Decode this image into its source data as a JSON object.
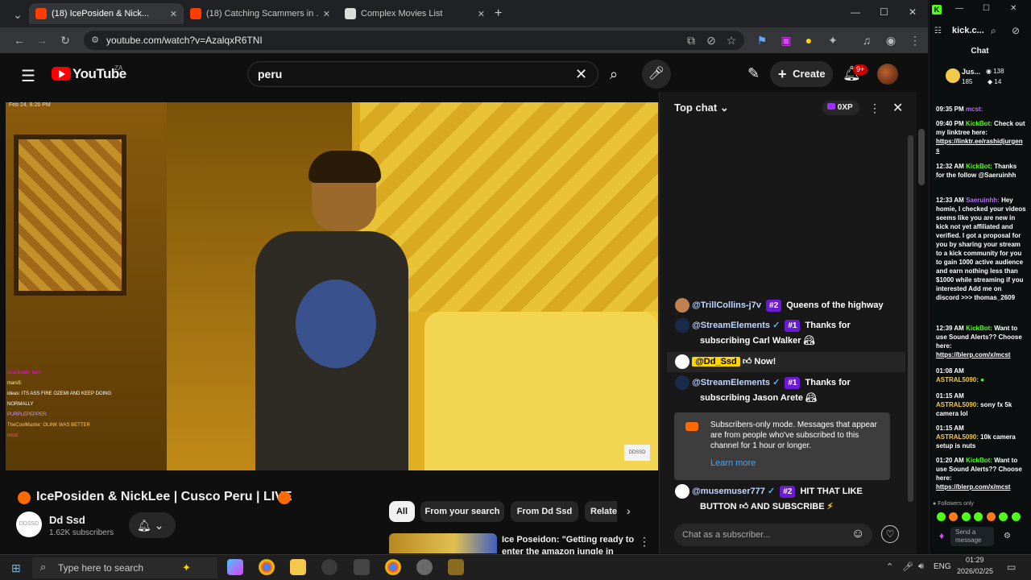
{
  "browser": {
    "tabs": [
      {
        "label": "(18) IcePosiden & Nick..."
      },
      {
        "label": "(18) Catching Scammers in ..."
      },
      {
        "label": "Complex Movies List"
      }
    ],
    "url": "youtube.com/watch?v=AzalqxR6TNI"
  },
  "youtube": {
    "logo": "YouTube",
    "region": "ZA",
    "search_value": "peru",
    "create_label": "Create",
    "notif_count": "9+",
    "video_title": "IcePosiden & NickLee | Cusco Peru | LIVE",
    "channel_name": "Dd Ssd",
    "subscribers": "1.62K subscribers",
    "chips": [
      "All",
      "From your search",
      "From Dd Ssd",
      "Relate"
    ],
    "up_next_title_1": "Ice Poseidon: \"Getting ready to",
    "up_next_title_2": "enter the amazon jungle in",
    "overlay_tag": "DDSSD"
  },
  "chat": {
    "header": "Top chat",
    "xp": "0XP",
    "messages": [
      {
        "author": "@TrillCollins-j7v",
        "badge": "#2",
        "text": "Queens of the highway"
      },
      {
        "author": "@StreamElements",
        "badge": "#1",
        "text": "Thanks for",
        "text2": "subscribing Carl Walker"
      },
      {
        "author": "@Dd_Ssd",
        "text": "Now!"
      },
      {
        "author": "@StreamElements",
        "badge": "#1",
        "text": "Thanks for",
        "text2": "subscribing Jason Arete"
      },
      {
        "author": "@musemuser777",
        "badge": "#2",
        "text": "HIT THAT LIKE",
        "text2": "BUTTON",
        "text3": "AND SUBSCRIBE"
      }
    ],
    "notice": "Subscribers-only mode. Messages that appear are from people who've subscribed to this channel for 1 hour or longer.",
    "learn_more": "Learn more",
    "input_placeholder": "Chat as a subscriber..."
  },
  "kick": {
    "tab_title": "kick.c...",
    "chat_label": "Chat",
    "user_label": "Jus...",
    "stat_1": "138",
    "stat_2": "185",
    "stat_3": "14",
    "messages": [
      {
        "time": "09:35 PM",
        "user": "mcst:",
        "text": ""
      },
      {
        "time": "09:40 PM",
        "user": "KickBot:",
        "text": "Check out my linktree here:",
        "link": "https://linktr.ee/rashidjurgen s"
      },
      {
        "time": "12:32 AM",
        "user": "KickBot:",
        "text": "Thanks for the follow @Saeruinhh"
      },
      {
        "time": "12:33 AM",
        "user": "Saeruinhh:",
        "text": "Hey homie, I checked your videos seems like you are new in kick not yet affiliated and verified. I got a proposal for you by sharing your stream to a kick community for you to gain 1000 active audience and earn nothing less than $1000 while streaming if you interested Add me on discord >>> thomas_2609"
      },
      {
        "time": "12:39 AM",
        "user": "KickBot:",
        "text": "Want to use Sound Alerts?? Choose here:",
        "link": "https://blerp.com/x/mcst"
      },
      {
        "time": "01:08 AM",
        "user": "ASTRAL5090:",
        "text": ""
      },
      {
        "time": "01:15 AM",
        "user": "ASTRAL5090:",
        "text": "sony fx 5k camera lol"
      },
      {
        "time": "01:15 AM",
        "user": "ASTRAL5090:",
        "text": "10k camera setup is nuts"
      },
      {
        "time": "01:20 AM",
        "user": "KickBot:",
        "text": "Want to use Sound Alerts?? Choose here:",
        "link": "https://blerp.com/x/mcst"
      }
    ],
    "followers_only": "Followers only",
    "send_placeholder": "Send a message"
  },
  "taskbar": {
    "search_placeholder": "Type here to search",
    "lang": "ENG",
    "time": "01:29",
    "date": "2026/02/25"
  },
  "colors": {
    "youtube_red": "#ff0000",
    "kick_green": "#53fc18",
    "member_purple": "#6a1bd3"
  }
}
